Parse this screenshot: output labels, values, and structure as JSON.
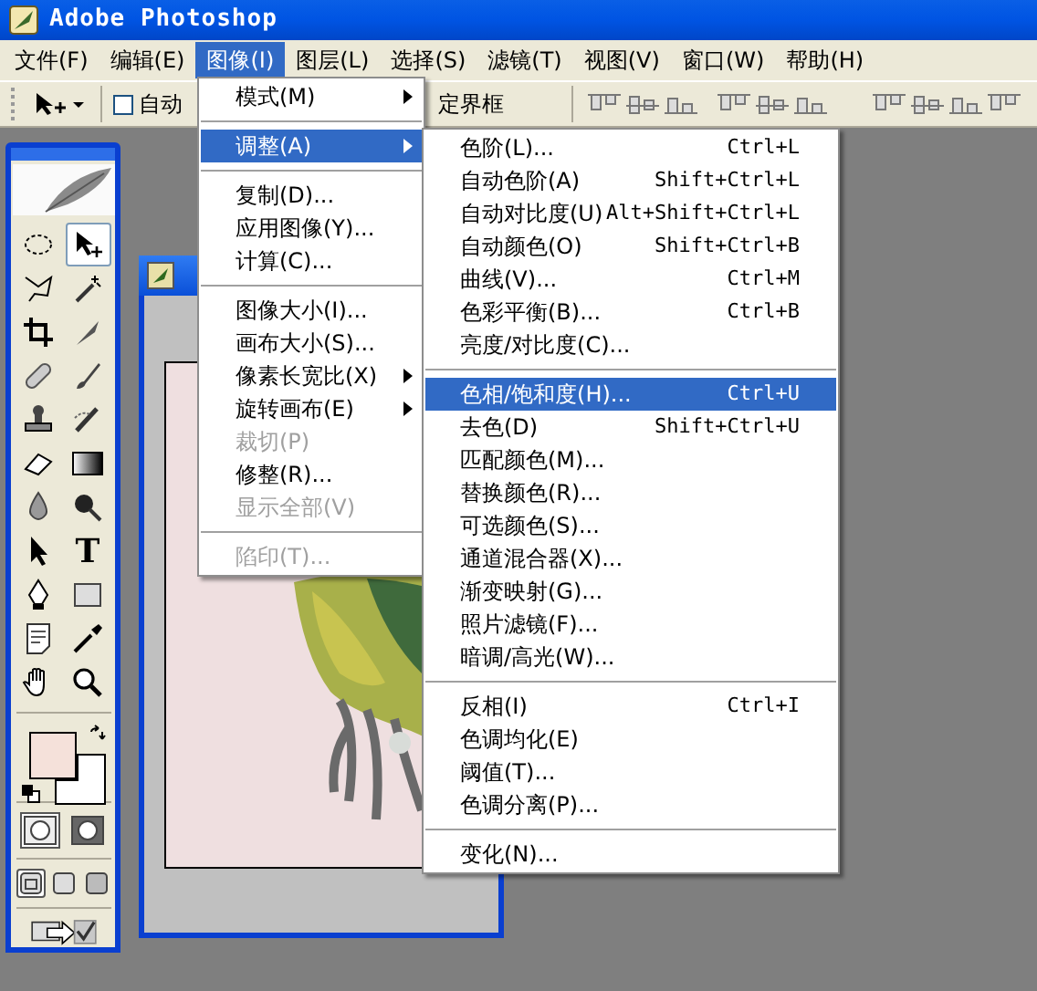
{
  "window": {
    "title": "Adobe Photoshop"
  },
  "menu_bar": [
    {
      "label": "文件(F)",
      "selected": false
    },
    {
      "label": "编辑(E)",
      "selected": false
    },
    {
      "label": "图像(I)",
      "selected": true
    },
    {
      "label": "图层(L)",
      "selected": false
    },
    {
      "label": "选择(S)",
      "selected": false
    },
    {
      "label": "滤镜(T)",
      "selected": false
    },
    {
      "label": "视图(V)",
      "selected": false
    },
    {
      "label": "窗口(W)",
      "selected": false
    },
    {
      "label": "帮助(H)",
      "selected": false
    }
  ],
  "options_bar": {
    "auto_select": {
      "label": "自动",
      "checked": false
    },
    "bounding_box_label": "定界框"
  },
  "tools": [
    {
      "kind": "marquee",
      "selected": false
    },
    {
      "kind": "move",
      "selected": true
    },
    {
      "kind": "lasso",
      "selected": false
    },
    {
      "kind": "wand",
      "selected": false
    },
    {
      "kind": "crop",
      "selected": false
    },
    {
      "kind": "slice",
      "selected": false
    },
    {
      "kind": "bandage",
      "selected": false
    },
    {
      "kind": "brush",
      "selected": false
    },
    {
      "kind": "stamp",
      "selected": false
    },
    {
      "kind": "history",
      "selected": false
    },
    {
      "kind": "eraser",
      "selected": false
    },
    {
      "kind": "gradient",
      "selected": false
    },
    {
      "kind": "drop",
      "selected": false
    },
    {
      "kind": "dodge",
      "selected": false
    },
    {
      "kind": "arrow",
      "selected": false
    },
    {
      "kind": "type",
      "label": "T",
      "selected": false
    },
    {
      "kind": "pen",
      "selected": false
    },
    {
      "kind": "shape",
      "selected": false
    },
    {
      "kind": "notes",
      "selected": false
    },
    {
      "kind": "eyedropper",
      "selected": false
    },
    {
      "kind": "hand",
      "selected": false
    },
    {
      "kind": "zoom",
      "selected": false
    }
  ],
  "mask_modes": [
    {
      "selected": true
    },
    {
      "selected": false
    }
  ],
  "screen_modes": [
    {
      "selected": true
    },
    {
      "selected": false
    },
    {
      "selected": false
    }
  ],
  "image_menu": [
    {
      "kind": "item",
      "label": "模式(M)",
      "submenu": true,
      "disabled": false,
      "selected": false
    },
    {
      "kind": "separator"
    },
    {
      "kind": "item",
      "label": "调整(A)",
      "submenu": true,
      "disabled": false,
      "selected": true
    },
    {
      "kind": "separator"
    },
    {
      "kind": "item",
      "label": "复制(D)...",
      "submenu": false,
      "disabled": false,
      "selected": false
    },
    {
      "kind": "item",
      "label": "应用图像(Y)...",
      "submenu": false,
      "disabled": false,
      "selected": false
    },
    {
      "kind": "item",
      "label": "计算(C)...",
      "submenu": false,
      "disabled": false,
      "selected": false
    },
    {
      "kind": "separator"
    },
    {
      "kind": "item",
      "label": "图像大小(I)...",
      "submenu": false,
      "disabled": false,
      "selected": false
    },
    {
      "kind": "item",
      "label": "画布大小(S)...",
      "submenu": false,
      "disabled": false,
      "selected": false
    },
    {
      "kind": "item",
      "label": "像素长宽比(X)",
      "submenu": true,
      "disabled": false,
      "selected": false
    },
    {
      "kind": "item",
      "label": "旋转画布(E)",
      "submenu": true,
      "disabled": false,
      "selected": false
    },
    {
      "kind": "item",
      "label": "裁切(P)",
      "submenu": false,
      "disabled": true,
      "selected": false
    },
    {
      "kind": "item",
      "label": "修整(R)...",
      "submenu": false,
      "disabled": false,
      "selected": false
    },
    {
      "kind": "item",
      "label": "显示全部(V)",
      "submenu": false,
      "disabled": true,
      "selected": false
    },
    {
      "kind": "separator"
    },
    {
      "kind": "item",
      "label": "陷印(T)...",
      "submenu": false,
      "disabled": true,
      "selected": false
    }
  ],
  "adjust_submenu": [
    {
      "kind": "item",
      "label": "色阶(L)...",
      "shortcut": "Ctrl+L",
      "selected": false
    },
    {
      "kind": "item",
      "label": "自动色阶(A)",
      "shortcut": "Shift+Ctrl+L",
      "selected": false
    },
    {
      "kind": "item",
      "label": "自动对比度(U)",
      "shortcut": "Alt+Shift+Ctrl+L",
      "selected": false
    },
    {
      "kind": "item",
      "label": "自动颜色(O)",
      "shortcut": "Shift+Ctrl+B",
      "selected": false
    },
    {
      "kind": "item",
      "label": "曲线(V)...",
      "shortcut": "Ctrl+M",
      "selected": false
    },
    {
      "kind": "item",
      "label": "色彩平衡(B)...",
      "shortcut": "Ctrl+B",
      "selected": false
    },
    {
      "kind": "item",
      "label": "亮度/对比度(C)...",
      "selected": false
    },
    {
      "kind": "separator"
    },
    {
      "kind": "item",
      "label": "色相/饱和度(H)...",
      "shortcut": "Ctrl+U",
      "selected": true
    },
    {
      "kind": "item",
      "label": "去色(D)",
      "shortcut": "Shift+Ctrl+U",
      "selected": false
    },
    {
      "kind": "item",
      "label": "匹配颜色(M)...",
      "selected": false
    },
    {
      "kind": "item",
      "label": "替换颜色(R)...",
      "selected": false
    },
    {
      "kind": "item",
      "label": "可选颜色(S)...",
      "selected": false
    },
    {
      "kind": "item",
      "label": "通道混合器(X)...",
      "selected": false
    },
    {
      "kind": "item",
      "label": "渐变映射(G)...",
      "selected": false
    },
    {
      "kind": "item",
      "label": "照片滤镜(F)...",
      "selected": false
    },
    {
      "kind": "item",
      "label": "暗调/高光(W)...",
      "selected": false
    },
    {
      "kind": "separator"
    },
    {
      "kind": "item",
      "label": "反相(I)",
      "shortcut": "Ctrl+I",
      "selected": false
    },
    {
      "kind": "item",
      "label": "色调均化(E)",
      "selected": false
    },
    {
      "kind": "item",
      "label": "阈值(T)...",
      "selected": false
    },
    {
      "kind": "item",
      "label": "色调分离(P)...",
      "selected": false
    },
    {
      "kind": "separator"
    },
    {
      "kind": "item",
      "label": "变化(N)...",
      "selected": false
    }
  ]
}
